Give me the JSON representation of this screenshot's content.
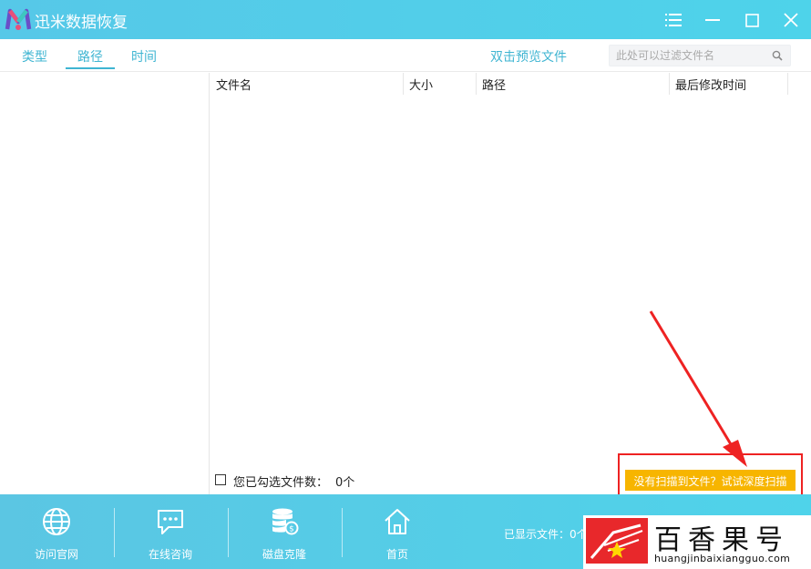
{
  "app": {
    "title": "迅米数据恢复"
  },
  "window_controls": {
    "menu_icon": "hamburger-icon",
    "minimize_icon": "minimize-icon",
    "maximize_icon": "maximize-icon",
    "close_icon": "close-icon"
  },
  "tabs": [
    {
      "label": "类型",
      "active": false
    },
    {
      "label": "路径",
      "active": true
    },
    {
      "label": "时间",
      "active": false
    }
  ],
  "toolbar": {
    "preview_label": "双击预览文件",
    "filter_placeholder": "此处可以过滤文件名",
    "filter_value": ""
  },
  "table": {
    "columns": [
      "文件名",
      "大小",
      "路径",
      "最后修改时间"
    ],
    "rows": []
  },
  "selection": {
    "label": "您已勾选文件数：",
    "count": "0个",
    "checked": false
  },
  "deep_scan": {
    "label": "没有扫描到文件？试试深度扫描"
  },
  "bottom_nav": [
    {
      "label": "访问官网",
      "icon": "globe-icon"
    },
    {
      "label": "在线咨询",
      "icon": "chat-icon"
    },
    {
      "label": "磁盘克隆",
      "icon": "disk-clone-icon"
    },
    {
      "label": "首页",
      "icon": "home-icon"
    }
  ],
  "footer": {
    "shown_label": "已显示文件：",
    "shown_count": "0个"
  },
  "watermark": {
    "name": "百香果号",
    "url": "huangjinbaixiangguo.com"
  },
  "colors": {
    "accent": "#3fb5d2",
    "bar": "#4ed3ea",
    "deep_scan_button": "#f7b500",
    "annotation": "#ee2222"
  }
}
